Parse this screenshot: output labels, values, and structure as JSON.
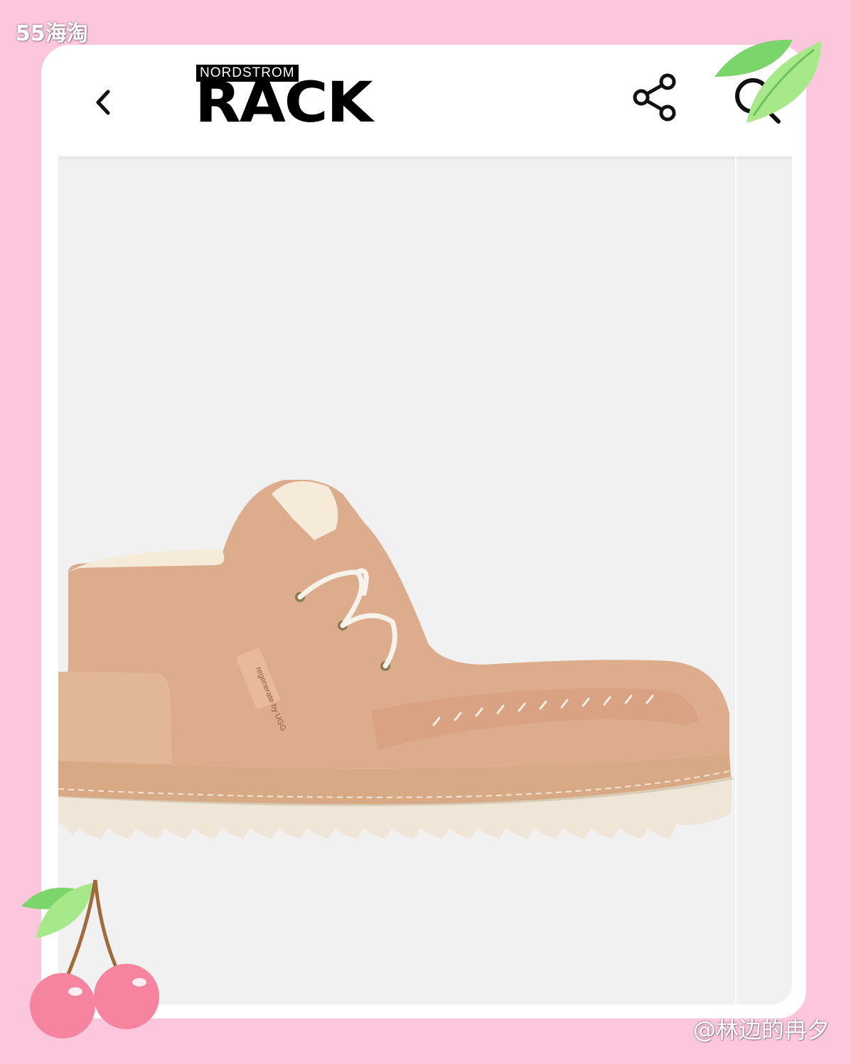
{
  "watermarks": {
    "top_left": "55海淘",
    "bottom_right": "@林边的冉夕"
  },
  "appbar": {
    "logo_top": "NORDSTROM",
    "logo_main": "RACK",
    "icons": [
      "chevron-left-icon",
      "share-icon",
      "search-icon"
    ]
  },
  "product": {
    "image_label": "regenerate by UGG"
  },
  "colors": {
    "background_pink": "#fcc6dc",
    "screen_bg": "#f1f1f1",
    "boot_tan": "#d9a98a",
    "sole_cream": "#efe6d8"
  }
}
